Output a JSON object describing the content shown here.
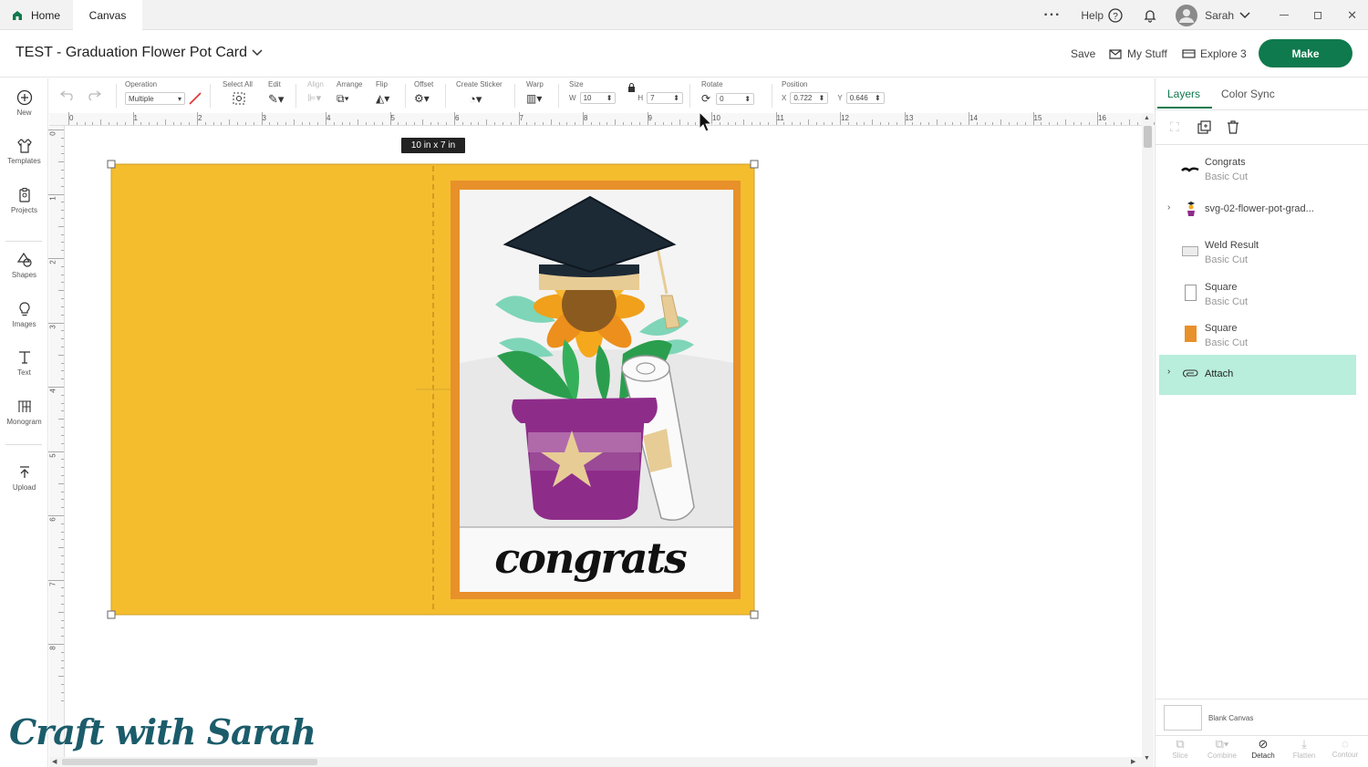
{
  "tabs": {
    "home": "Home",
    "canvas": "Canvas"
  },
  "topbar": {
    "help": "Help",
    "user": "Sarah"
  },
  "header": {
    "title": "TEST - Graduation Flower Pot Card",
    "save": "Save",
    "my_stuff": "My Stuff",
    "machine": "Explore 3",
    "make": "Make"
  },
  "sidebar": {
    "items": [
      {
        "label": "New"
      },
      {
        "label": "Templates"
      },
      {
        "label": "Projects"
      },
      {
        "label": "Shapes"
      },
      {
        "label": "Images"
      },
      {
        "label": "Text"
      },
      {
        "label": "Monogram"
      },
      {
        "label": "Upload"
      }
    ]
  },
  "toolbar": {
    "operation_label": "Operation",
    "operation_value": "Multiple",
    "select_all": "Select All",
    "edit": "Edit",
    "align": "Align",
    "arrange": "Arrange",
    "flip": "Flip",
    "offset": "Offset",
    "create_sticker": "Create Sticker",
    "warp": "Warp",
    "size_label": "Size",
    "w_label": "W",
    "w_value": "10",
    "h_label": "H",
    "h_value": "7",
    "rotate_label": "Rotate",
    "rotate_value": "0",
    "position_label": "Position",
    "x_label": "X",
    "x_value": "0.722",
    "y_label": "Y",
    "y_value": "0.646"
  },
  "ruler": {
    "top": [
      "0",
      "1",
      "2",
      "3",
      "4",
      "5",
      "6",
      "7",
      "8",
      "9",
      "10",
      "11",
      "12",
      "13",
      "14",
      "15",
      "16"
    ],
    "left": [
      "0",
      "1",
      "2",
      "3",
      "4",
      "5",
      "6",
      "7",
      "8"
    ]
  },
  "canvas": {
    "size_tooltip": "10 in x 7 in",
    "card_text": "congrats",
    "colors": {
      "card": "#f4bd2e",
      "border": "#e8902a",
      "pot": "#8e2c8a",
      "cap": "#1c2a36"
    }
  },
  "panel": {
    "tabs": [
      "Layers",
      "Color Sync"
    ],
    "layers": [
      {
        "name": "Congrats",
        "sub": "Basic Cut"
      },
      {
        "name": "svg-02-flower-pot-grad...",
        "sub": ""
      },
      {
        "name": "Weld Result",
        "sub": "Basic Cut"
      },
      {
        "name": "Square",
        "sub": "Basic Cut"
      },
      {
        "name": "Square",
        "sub": "Basic Cut"
      },
      {
        "name": "Attach",
        "sub": ""
      }
    ],
    "blank_canvas": "Blank Canvas",
    "actions": [
      "Slice",
      "Combine",
      "Detach",
      "Flatten",
      "Contour"
    ]
  },
  "watermark": "Craft with Sarah"
}
